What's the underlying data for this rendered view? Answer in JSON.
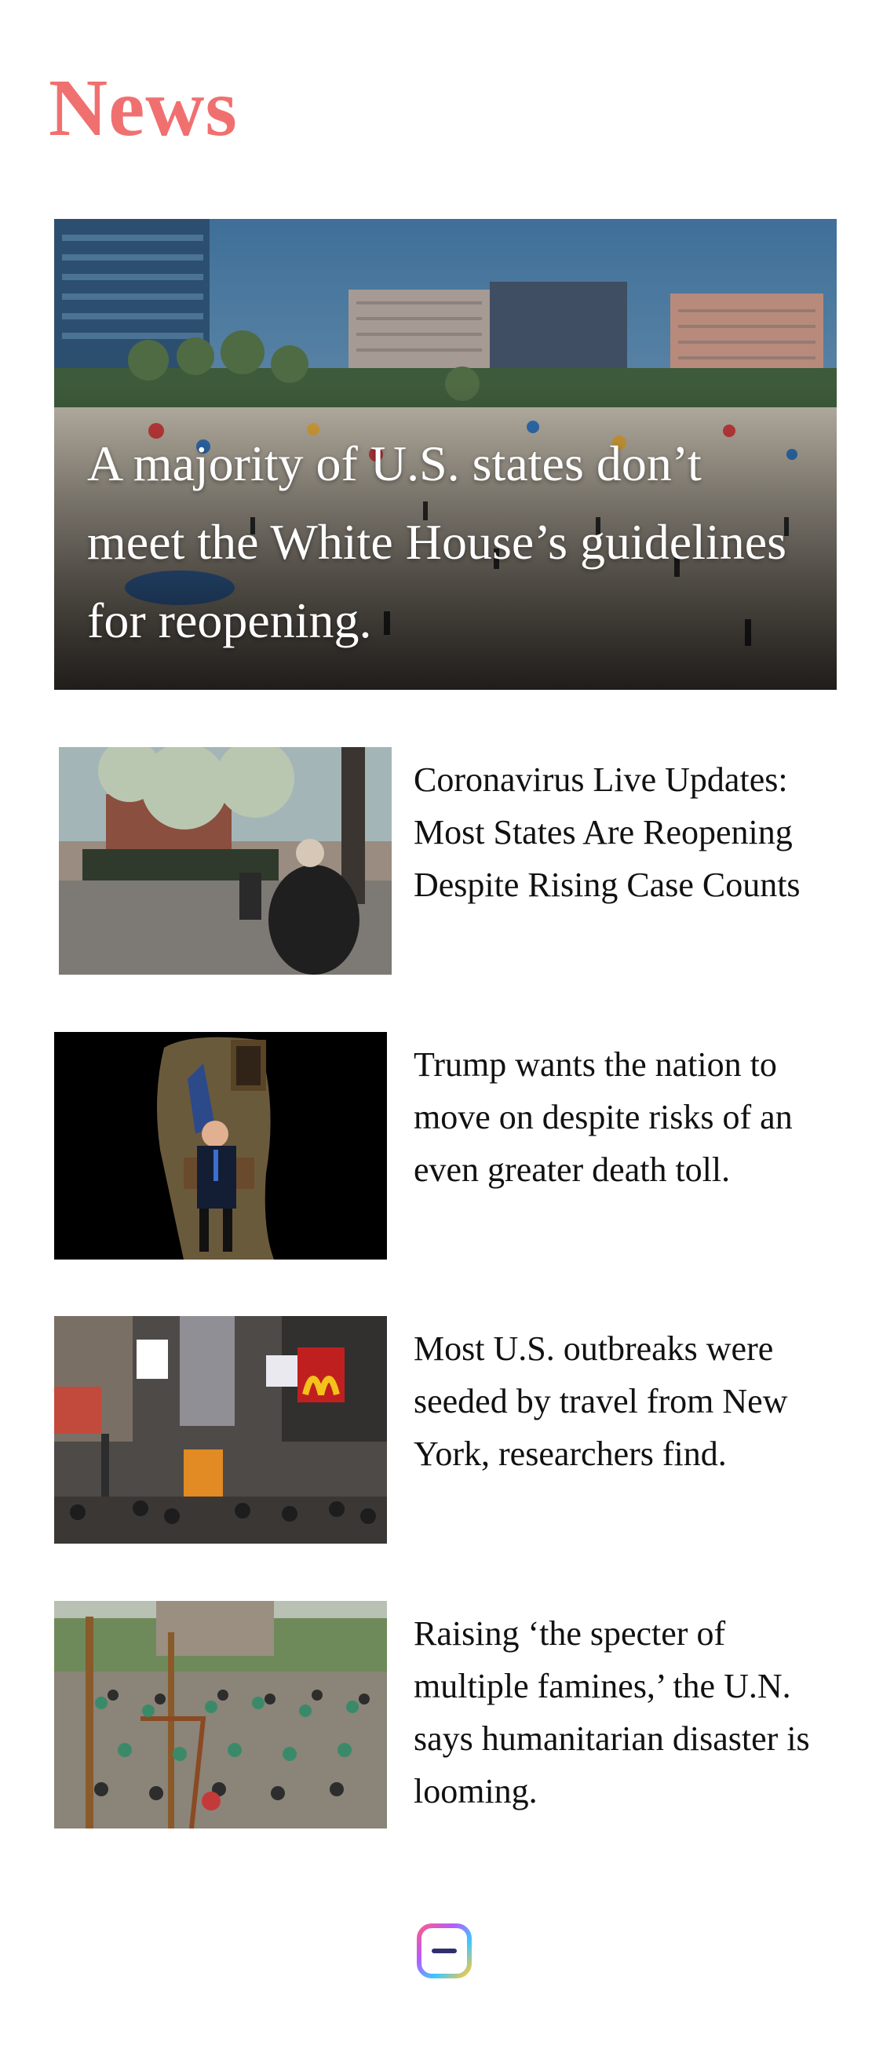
{
  "header": {
    "title": "News",
    "title_color": "#f07070"
  },
  "hero": {
    "headline": "A majority of U.S. states don’t meet the White House’s guidelines for reopening."
  },
  "articles": [
    {
      "headline": "Coronavirus Live Updates: Most States Are Reopening Despite Rising Case Counts"
    },
    {
      "headline": "Trump wants the nation to move on despite risks of an even greater death toll."
    },
    {
      "headline": "Most U.S. outbreaks were seeded by travel from New York, researchers find."
    },
    {
      "headline": "Raising ‘the specter of multiple famines,’ the U.N. says humanitarian disaster is looming."
    }
  ],
  "tab_bar": {
    "icon": "app-switcher-icon"
  }
}
